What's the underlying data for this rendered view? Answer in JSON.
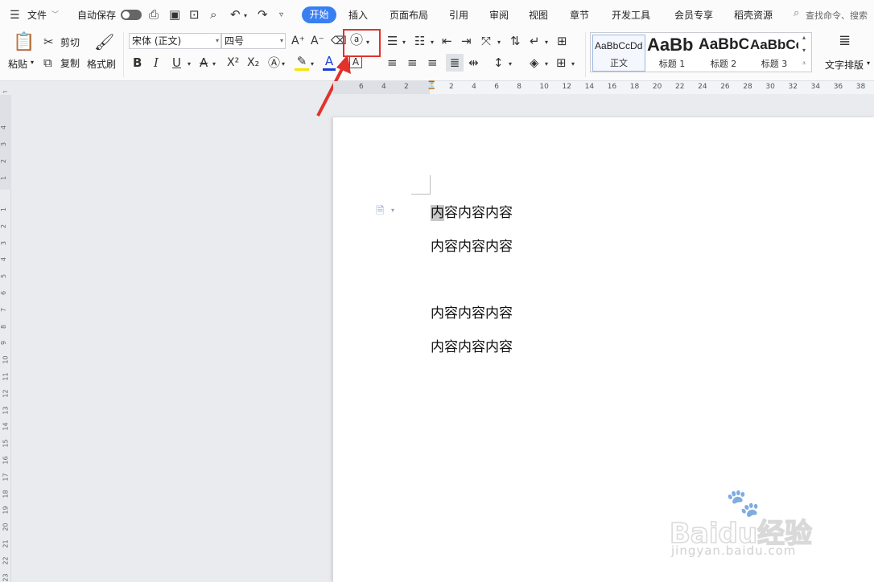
{
  "menu": {
    "file": "文件",
    "autosave": "自动保存",
    "tabs": [
      "开始",
      "插入",
      "页面布局",
      "引用",
      "审阅",
      "视图",
      "章节",
      "开发工具",
      "会员专享",
      "稻壳资源"
    ],
    "active_tab": "开始",
    "search": "查找命令、搜索"
  },
  "clipboard": {
    "paste": "粘贴",
    "cut": "剪切",
    "copy": "复制",
    "format_painter": "格式刷"
  },
  "font": {
    "name": "宋体 (正文)",
    "size": "四号"
  },
  "styles": [
    {
      "preview": "AaBbCcDd",
      "name": "正文"
    },
    {
      "preview": "AaBb",
      "name": "标题 1"
    },
    {
      "preview": "AaBbC",
      "name": "标题 2"
    },
    {
      "preview": "AaBbCc",
      "name": "标题 3"
    }
  ],
  "text_layout": "文字排版",
  "ruler_h": [
    "6",
    "4",
    "2",
    "2",
    "4",
    "6",
    "8",
    "10",
    "12",
    "14",
    "16",
    "18",
    "20",
    "22",
    "24",
    "26",
    "28",
    "30",
    "32",
    "34",
    "36",
    "38"
  ],
  "ruler_v": [
    "4",
    "3",
    "2",
    "1",
    "1",
    "2",
    "3",
    "4",
    "5",
    "6",
    "7",
    "8",
    "9",
    "10",
    "11",
    "12",
    "13",
    "14",
    "15",
    "16",
    "17",
    "18",
    "19",
    "20",
    "21",
    "22",
    "23"
  ],
  "document": {
    "paragraphs": [
      {
        "highlight": "内",
        "rest": "容内容内容"
      },
      {
        "highlight": "",
        "rest": "内容内容内容"
      },
      {
        "highlight": "",
        "rest": "内容内容内容"
      },
      {
        "highlight": "",
        "rest": "内容内容内容"
      }
    ]
  },
  "watermark": {
    "brand": "Baidu经验",
    "url": "jingyan.baidu.com"
  },
  "colors": {
    "accent": "#3a7ff2",
    "annotation": "#e1322c",
    "highlight": "#c8c8c8"
  }
}
